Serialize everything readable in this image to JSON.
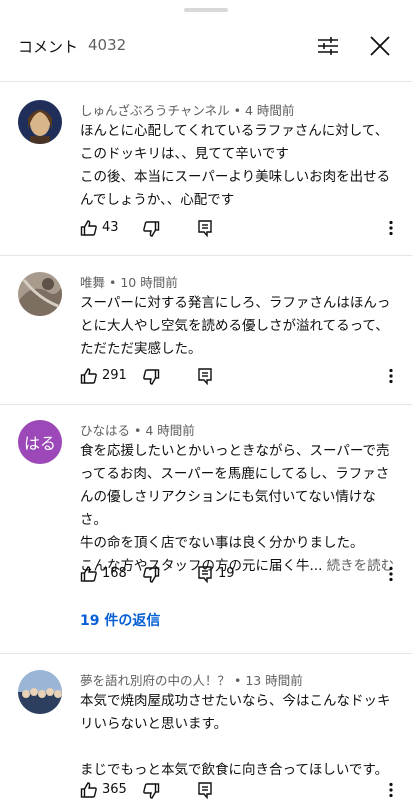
{
  "header": {
    "title": "コメント",
    "count": "4032"
  },
  "comments": [
    {
      "author": "しゅんざぶろうチャンネル",
      "time": "4 時間前",
      "lines": [
        "ほんとに心配してくれているラファさんに対して、このドッキリは、、見てて辛いです",
        "この後、本当にスーパーより美味しいお肉を出せるんでしょうか、、心配です"
      ],
      "likes": "43"
    },
    {
      "author": "唯舞",
      "time": "10 時間前",
      "lines": [
        "スーパーに対する発言にしろ、ラファさんはほんっとに大人やし空気を読める優しさが溢れてるって、ただただ実感した。"
      ],
      "likes": "291"
    },
    {
      "author": "ひなはる",
      "time": "4 時間前",
      "avatar_text": "はる",
      "lines": [
        "食を応援したいとかいっときながら、スーパーで売ってるお肉、スーパーを馬鹿にしてるし、ラファさんの優しさリアクションにも気付いてない情けなさ。",
        "牛の命を頂く店でない事は良く分かりました。",
        "こんな方やスタッフの方の元に届く牛..."
      ],
      "read_more": "続きを読む",
      "likes": "168",
      "reply_count": "19",
      "replies_link": "19 件の返信"
    },
    {
      "author": "夢を語れ別府の中の人！？",
      "time": "13 時間前",
      "lines": [
        "本気で焼肉屋成功させたいなら、今はこんなドッキリいらないと思います。",
        "",
        "まじでもっと本気で飲食に向き合ってほしいです。"
      ],
      "likes": "365"
    }
  ],
  "separator": " • ",
  "colors": {
    "text": "#0f0f0f",
    "secondary": "#606060",
    "link": "#065fd4",
    "avatar_purple": "#9c48b8"
  }
}
